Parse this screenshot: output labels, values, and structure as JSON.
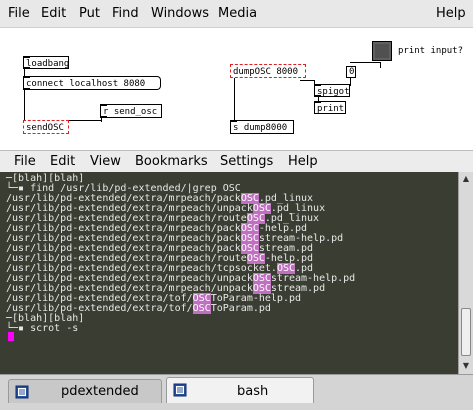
{
  "pd_window": {
    "menu": [
      "File",
      "Edit",
      "Put",
      "Find",
      "Windows",
      "Media",
      "Help"
    ],
    "objects": {
      "loadbang": "loadbang",
      "connect": "connect localhost 8080",
      "r_send_osc": "r send_osc",
      "sendOSC": "sendOSC",
      "dumpOSC": "dumpOSC 8000",
      "spigot": "spigot",
      "print": "print",
      "s_dump": "s dump8000",
      "number": "0"
    },
    "toggle_label": "print input?"
  },
  "terminal": {
    "menu": [
      "File",
      "Edit",
      "View",
      "Bookmarks",
      "Settings",
      "Help"
    ],
    "lines": [
      [
        {
          "t": "─[blah][blah]"
        }
      ],
      [
        {
          "t": "└─▪ find /usr/lib/pd-extended/|grep OSC"
        }
      ],
      [
        {
          "t": "/usr/lib/pd-extended/extra/mrpeach/pack"
        },
        {
          "t": "OSC",
          "h": true
        },
        {
          "t": ".pd_linux"
        }
      ],
      [
        {
          "t": "/usr/lib/pd-extended/extra/mrpeach/unpack"
        },
        {
          "t": "OSC",
          "h": true
        },
        {
          "t": ".pd_linux"
        }
      ],
      [
        {
          "t": "/usr/lib/pd-extended/extra/mrpeach/route"
        },
        {
          "t": "OSC",
          "h": true
        },
        {
          "t": ".pd_linux"
        }
      ],
      [
        {
          "t": "/usr/lib/pd-extended/extra/mrpeach/pack"
        },
        {
          "t": "OSC",
          "h": true
        },
        {
          "t": "-help.pd"
        }
      ],
      [
        {
          "t": "/usr/lib/pd-extended/extra/mrpeach/pack"
        },
        {
          "t": "OSC",
          "h": true
        },
        {
          "t": "stream-help.pd"
        }
      ],
      [
        {
          "t": "/usr/lib/pd-extended/extra/mrpeach/pack"
        },
        {
          "t": "OSC",
          "h": true
        },
        {
          "t": "stream.pd"
        }
      ],
      [
        {
          "t": "/usr/lib/pd-extended/extra/mrpeach/route"
        },
        {
          "t": "OSC",
          "h": true
        },
        {
          "t": "-help.pd"
        }
      ],
      [
        {
          "t": "/usr/lib/pd-extended/extra/mrpeach/tcpsocket."
        },
        {
          "t": "OSC",
          "h": true
        },
        {
          "t": ".pd"
        }
      ],
      [
        {
          "t": "/usr/lib/pd-extended/extra/mrpeach/unpack"
        },
        {
          "t": "OSC",
          "h": true
        },
        {
          "t": "stream-help.pd"
        }
      ],
      [
        {
          "t": "/usr/lib/pd-extended/extra/mrpeach/unpack"
        },
        {
          "t": "OSC",
          "h": true
        },
        {
          "t": "stream.pd"
        }
      ],
      [
        {
          "t": "/usr/lib/pd-extended/extra/tof/"
        },
        {
          "t": "OSC",
          "h": true
        },
        {
          "t": "ToParam-help.pd"
        }
      ],
      [
        {
          "t": "/usr/lib/pd-extended/extra/tof/"
        },
        {
          "t": "OSC",
          "h": true
        },
        {
          "t": "ToParam.pd"
        }
      ],
      [
        {
          "t": "─[blah][blah]"
        }
      ],
      [
        {
          "t": "└─▪ scrot -s"
        }
      ]
    ],
    "tabs": [
      "pdextended",
      "bash"
    ],
    "cursor_color": "#ff00ff"
  }
}
